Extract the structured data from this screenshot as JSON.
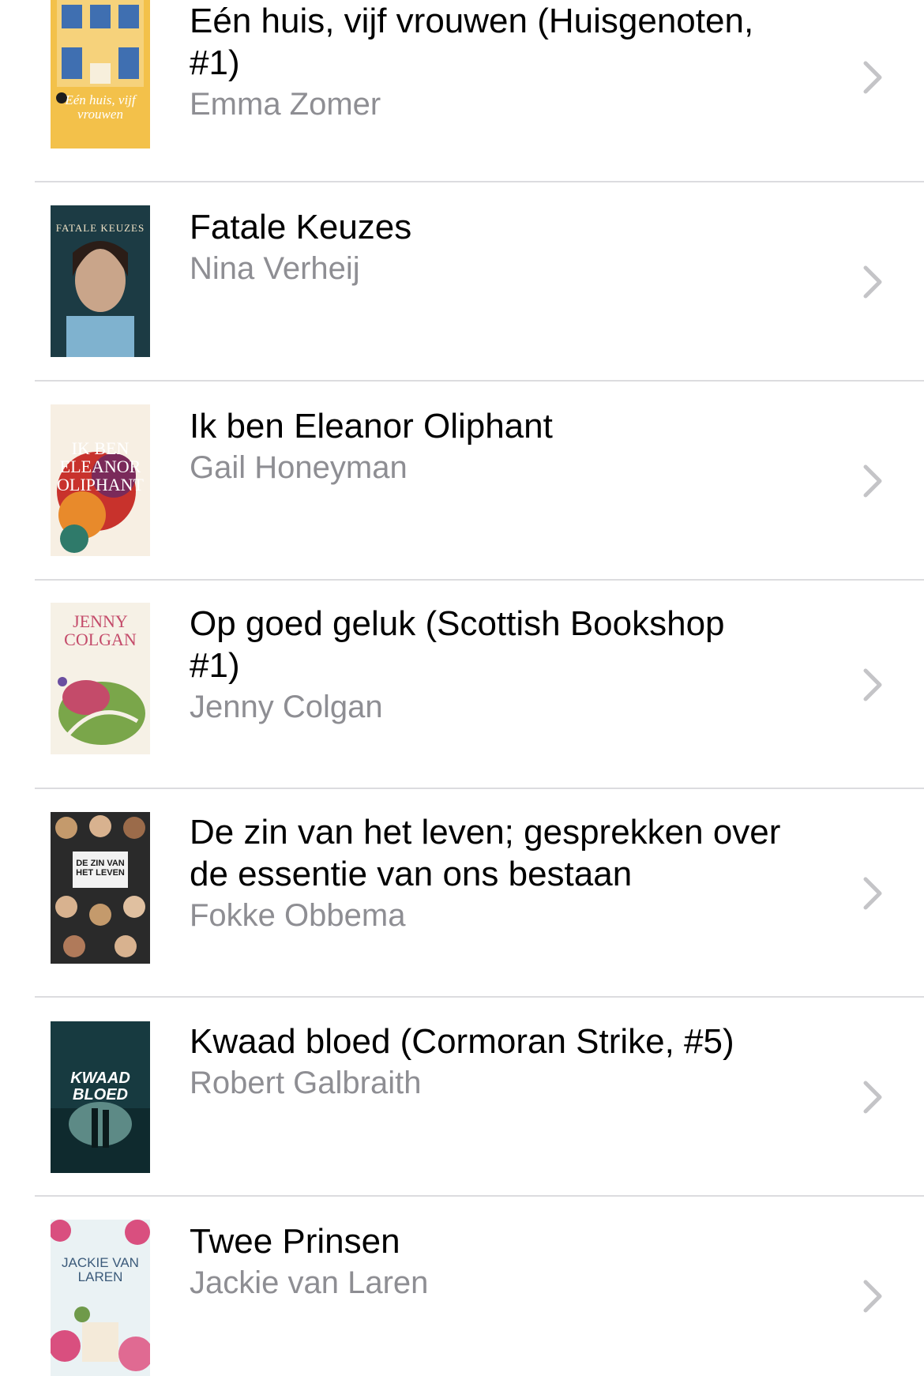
{
  "books": [
    {
      "title_line1": "Eén huis, vijf vrouwen (Huisgenoten,",
      "title_line2": "#1)",
      "author": "Emma Zomer",
      "cover": {
        "bg": "#f3c14a",
        "accent": "#3f6fb1",
        "text": "Eén huis, vijf vrouwen",
        "text_color": "#ffffff"
      },
      "chevron_icon": "chevron-right-icon"
    },
    {
      "title_line1": "Fatale Keuzes",
      "title_line2": "",
      "author": "Nina Verheij",
      "cover": {
        "bg": "#1c3b44",
        "accent": "#9ec4d6",
        "text": "FATALE KEUZES",
        "text_color": "#f1e3c6"
      },
      "chevron_icon": "chevron-right-icon"
    },
    {
      "title_line1": "Ik ben Eleanor Oliphant",
      "title_line2": "",
      "author": "Gail Honeyman",
      "cover": {
        "bg": "#f7efe3",
        "accent": "#c8322c",
        "text": "IK BEN ELEANOR OLIPHANT",
        "text_color": "#ffffff"
      },
      "chevron_icon": "chevron-right-icon"
    },
    {
      "title_line1": "Op goed geluk (Scottish Bookshop",
      "title_line2": "#1)",
      "author": "Jenny Colgan",
      "cover": {
        "bg": "#f6f1e6",
        "accent": "#7aa64a",
        "text": "JENNY COLGAN",
        "text_color": "#c44b6a"
      },
      "chevron_icon": "chevron-right-icon"
    },
    {
      "title_line1": "De zin van het leven; gesprekken over",
      "title_line2": "de essentie van ons bestaan",
      "author": "Fokke Obbema",
      "cover": {
        "bg": "#2a2a2a",
        "accent": "#f2f2f2",
        "text": "DE ZIN VAN HET LEVEN",
        "text_color": "#1a1a1a"
      },
      "chevron_icon": "chevron-right-icon"
    },
    {
      "title_line1": "Kwaad bloed (Cormoran Strike, #5)",
      "title_line2": "",
      "author": "Robert Galbraith",
      "cover": {
        "bg": "#173a40",
        "accent": "#5d8a86",
        "text": "KWAAD BLOED",
        "text_color": "#ffffff"
      },
      "chevron_icon": "chevron-right-icon"
    },
    {
      "title_line1": "Twee Prinsen",
      "title_line2": "",
      "author": "Jackie van Laren",
      "cover": {
        "bg": "#eaf2f4",
        "accent": "#d94f7f",
        "text": "JACKIE VAN LAREN",
        "text_color": "#3b5a7a"
      },
      "chevron_icon": "chevron-right-icon"
    }
  ],
  "colors": {
    "title": "#000000",
    "author": "#8e8e93",
    "chevron": "#c4c4c7",
    "separator": "#dcdcdf"
  }
}
